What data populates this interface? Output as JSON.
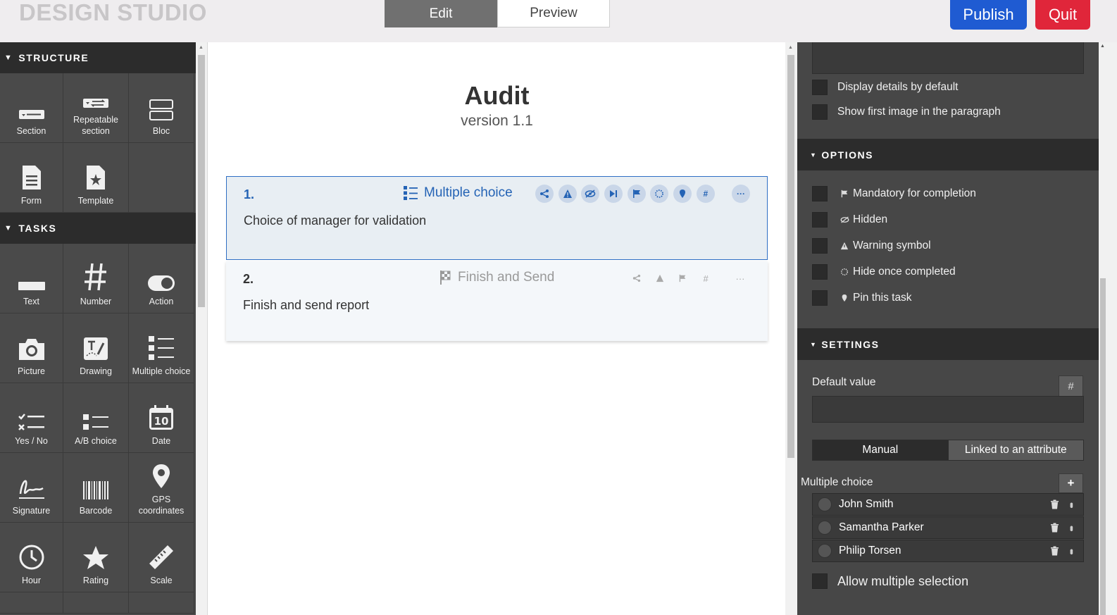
{
  "app": {
    "brand": "DESIGN STUDIO"
  },
  "header": {
    "modes": [
      "Edit",
      "Preview"
    ],
    "active_mode": "Edit",
    "publish_label": "Publish",
    "quit_label": "Quit",
    "colors": {
      "publish": "#1f5bd2",
      "quit": "#e0263a"
    }
  },
  "palette": {
    "structure_title": "STRUCTURE",
    "structure_items": [
      {
        "label": "Section",
        "icon": "section-icon"
      },
      {
        "label": "Repeatable section",
        "icon": "repeatable-section-icon"
      },
      {
        "label": "Bloc",
        "icon": "bloc-icon"
      },
      {
        "label": "Form",
        "icon": "form-icon"
      },
      {
        "label": "Template",
        "icon": "template-icon"
      }
    ],
    "tasks_title": "TASKS",
    "task_items": [
      {
        "label": "Text",
        "icon": "text-icon"
      },
      {
        "label": "Number",
        "icon": "number-icon"
      },
      {
        "label": "Action",
        "icon": "toggle-icon"
      },
      {
        "label": "Picture",
        "icon": "camera-icon"
      },
      {
        "label": "Drawing",
        "icon": "drawing-icon"
      },
      {
        "label": "Multiple choice",
        "icon": "multiple-choice-icon"
      },
      {
        "label": "Yes / No",
        "icon": "yes-no-icon"
      },
      {
        "label": "A/B choice",
        "icon": "ab-choice-icon"
      },
      {
        "label": "Date",
        "icon": "calendar-icon"
      },
      {
        "label": "Signature",
        "icon": "signature-icon"
      },
      {
        "label": "Barcode",
        "icon": "barcode-icon"
      },
      {
        "label": "GPS coordinates",
        "icon": "map-pin-icon"
      },
      {
        "label": "Hour",
        "icon": "clock-icon"
      },
      {
        "label": "Rating",
        "icon": "star-icon"
      },
      {
        "label": "Scale",
        "icon": "ruler-icon"
      }
    ]
  },
  "document": {
    "title": "Audit",
    "version": "version 1.1",
    "tasks": [
      {
        "number": "1.",
        "type": "Multiple choice",
        "label": "Choice of manager for validation"
      },
      {
        "number": "2.",
        "type": "Finish and Send",
        "label": "Finish and send report"
      }
    ]
  },
  "properties": {
    "display_details": "Display details by default",
    "show_first_image": "Show first image in the paragraph",
    "options_title": "OPTIONS",
    "options": [
      {
        "label": "Mandatory for completion",
        "icon": "flag-icon"
      },
      {
        "label": "Hidden",
        "icon": "eye-off-icon"
      },
      {
        "label": "Warning symbol",
        "icon": "warning-icon"
      },
      {
        "label": "Hide once completed",
        "icon": "dotted-circle-icon"
      },
      {
        "label": "Pin this task",
        "icon": "pin-icon"
      }
    ],
    "settings_title": "SETTINGS",
    "default_value_label": "Default value",
    "hash_label": "#",
    "toggle": {
      "manual": "Manual",
      "linked": "Linked to an attribute"
    },
    "multiple_choice_label": "Multiple choice",
    "plus_label": "+",
    "choices": [
      "John Smith",
      "Samantha Parker",
      "Philip Torsen"
    ],
    "allow_multiple": "Allow multiple selection"
  }
}
